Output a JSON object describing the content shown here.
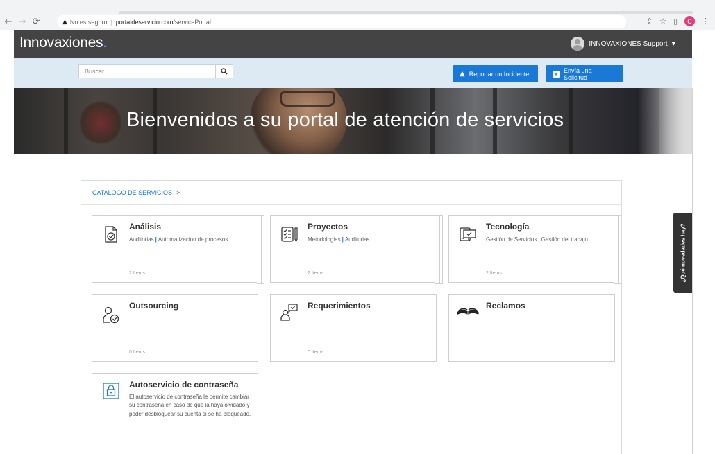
{
  "browser": {
    "security_label": "No es seguro",
    "url_host": "portaldeservicio.com",
    "url_path": "/servicePortal",
    "profile_initial": "C"
  },
  "header": {
    "logo_main": "Innovaxiones",
    "logo_dot": ".",
    "user_name": "INNOVAXIONES Support"
  },
  "search": {
    "placeholder": "Buscar"
  },
  "actions": {
    "incident_label": "Reportar un Incidente",
    "request_label": "Envía una Solicitud"
  },
  "hero": {
    "title": "Bienvenidos a su portal de atención de servicios"
  },
  "catalog": {
    "breadcrumb": "CATALOGO DE SERVICIOS",
    "breadcrumb_sep": ">",
    "cards": [
      {
        "title": "Análisis",
        "link1": "Auditorias",
        "link2": "Automatizacion de procesos",
        "count": "2 Items",
        "icon": "document-check-icon"
      },
      {
        "title": "Proyectos",
        "link1": "Metodologias",
        "link2": "Auditorias",
        "count": "2 Items",
        "icon": "checklist-icon"
      },
      {
        "title": "Tecnología",
        "link1": "Gestión de Servicios",
        "link2": "Gestión del trabajo",
        "count": "2 Items",
        "icon": "monitor-check-icon"
      },
      {
        "title": "Outsourcing",
        "count": "0 Items",
        "icon": "person-check-icon"
      },
      {
        "title": "Requerimientos",
        "count": "0 Items",
        "icon": "person-chat-icon"
      },
      {
        "title": "Reclamos",
        "icon": "open-book-icon"
      },
      {
        "title": "Autoservicio de contraseña",
        "description": "El autoservicio de contraseña le permite cambiar su contraseña en caso de que la haya olvidado y poder desbloquear su cuenta si se ha bloqueado.",
        "icon": "lock-icon"
      }
    ]
  },
  "side_tab": {
    "label": "¿Qué novedades hay?"
  },
  "colors": {
    "accent": "#1a78d6",
    "header_bg": "#444444",
    "search_band": "#dde9f3"
  }
}
